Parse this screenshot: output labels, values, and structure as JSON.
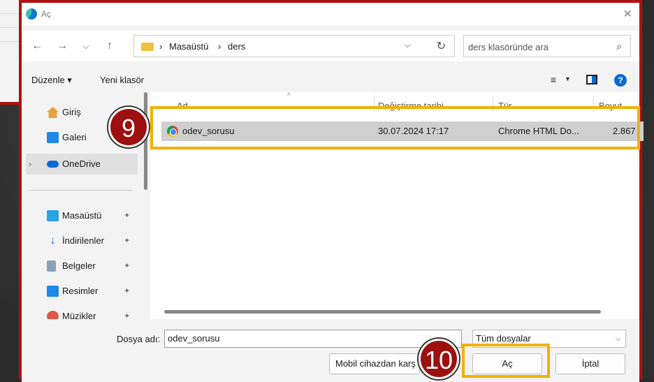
{
  "dialog": {
    "title": "Aç",
    "close_glyph": "✕"
  },
  "nav": {
    "back_icon": "←",
    "forward_icon": "→",
    "history_icon": "⌵",
    "up_icon": "↑",
    "breadcrumb": [
      "Masaüstü",
      "ders"
    ],
    "sep": "›",
    "chevron": "⌵",
    "refresh_icon": "↻",
    "search_placeholder": "ders klasöründe ara",
    "search_icon": "⌕"
  },
  "toolbar": {
    "organize": "Düzenle ▾",
    "new_folder": "Yeni klasör",
    "view_icon": "≡",
    "view_caret": "▼",
    "help": "?"
  },
  "sidebar": {
    "home": "Giriş",
    "gallery": "Galeri",
    "onedrive": "OneDrive",
    "expand": "›",
    "pinned": [
      "Masaüstü",
      "İndirilenler",
      "Belgeler",
      "Resimler",
      "Müzikler"
    ],
    "pin_glyph": "✦"
  },
  "columns": {
    "name": "Ad",
    "modified": "Değiştirme tarihi",
    "type": "Tür",
    "size": "Boyut",
    "sort_arrow": "^"
  },
  "files": [
    {
      "name": "odev_sorusu",
      "modified": "30.07.2024 17:17",
      "type": "Chrome HTML Do...",
      "size": "2.867"
    }
  ],
  "bottom": {
    "filename_label": "Dosya adı:",
    "filename_value": "odev_sorusu",
    "filetype": "Tüm dosyalar",
    "filetype_caret": "⌵",
    "mobile_button": "Mobil cihazdan karş",
    "open_button": "Aç",
    "cancel_button": "İptal"
  },
  "annotations": {
    "step_9": "9",
    "step_10": "10",
    "highlight_color": "#f2b100",
    "badge_color": "#9c1010"
  }
}
